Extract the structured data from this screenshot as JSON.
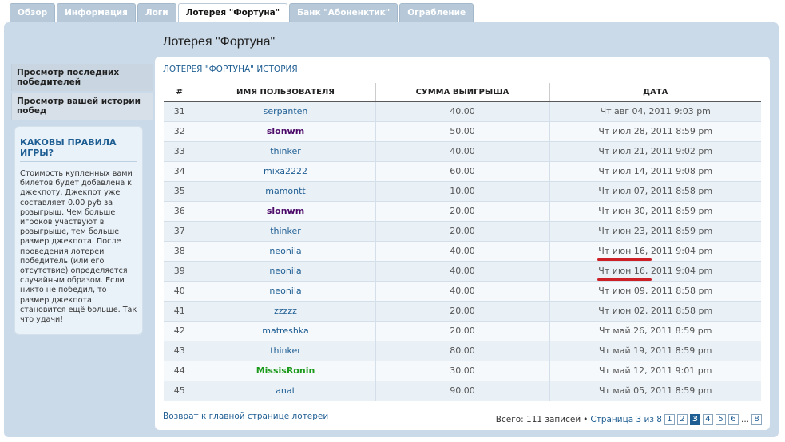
{
  "tabs": [
    {
      "label": "Обзор",
      "active": false
    },
    {
      "label": "Информация",
      "active": false
    },
    {
      "label": "Логи",
      "active": false
    },
    {
      "label": "Лотерея \"Фортуна\"",
      "active": true
    },
    {
      "label": "Банк \"Абоненктик\"",
      "active": false
    },
    {
      "label": "Ограбление",
      "active": false
    }
  ],
  "page_title": "Лотерея \"Фортуна\"",
  "sidebar": {
    "links": [
      {
        "label": "Просмотр последних победителей"
      },
      {
        "label": "Просмотр вашей истории побед"
      }
    ],
    "rules": {
      "title": "КАКОВЫ ПРАВИЛА ИГРЫ?",
      "text": "Стоимость купленных вами билетов будет добавлена к джекпоту. Джекпот уже составляет 0.00 руб за розыгрыш. Чем больше игроков участвуют в розыгрыше, тем больше размер джекпота. После проведения лотереи победитель (или его отсутствие) определяется случайным образом. Если никто не победил, то размер джекпота становится ещё больше. Так что удачи!"
    }
  },
  "history": {
    "title": "ЛОТЕРЕЯ \"ФОРТУНА\" ИСТОРИЯ",
    "columns": [
      "#",
      "ИМЯ ПОЛЬЗОВАТЕЛЯ",
      "СУММА ВЫИГРЫША",
      "ДАТА"
    ],
    "rows": [
      {
        "num": "31",
        "user": "serpanten",
        "style": "normal",
        "amount": "40.00",
        "date": "Чт авг 04, 2011 9:03 pm"
      },
      {
        "num": "32",
        "user": "slonwm",
        "style": "bold-purple",
        "amount": "50.00",
        "date": "Чт июл 28, 2011 8:59 pm"
      },
      {
        "num": "33",
        "user": "thinker",
        "style": "normal",
        "amount": "40.00",
        "date": "Чт июл 21, 2011 9:02 pm"
      },
      {
        "num": "34",
        "user": "mixa2222",
        "style": "normal",
        "amount": "60.00",
        "date": "Чт июл 14, 2011 9:08 pm"
      },
      {
        "num": "35",
        "user": "mamontt",
        "style": "normal",
        "amount": "10.00",
        "date": "Чт июл 07, 2011 8:58 pm"
      },
      {
        "num": "36",
        "user": "slonwm",
        "style": "bold-purple",
        "amount": "20.00",
        "date": "Чт июн 30, 2011 8:59 pm"
      },
      {
        "num": "37",
        "user": "thinker",
        "style": "normal",
        "amount": "20.00",
        "date": "Чт июн 23, 2011 8:59 pm"
      },
      {
        "num": "38",
        "user": "neonila",
        "style": "normal",
        "amount": "40.00",
        "date": "Чт июн 16, 2011 9:04 pm",
        "marked": true
      },
      {
        "num": "39",
        "user": "neonila",
        "style": "normal",
        "amount": "40.00",
        "date": "Чт июн 16, 2011 9:04 pm",
        "marked": true
      },
      {
        "num": "40",
        "user": "neonila",
        "style": "normal",
        "amount": "40.00",
        "date": "Чт июн 09, 2011 8:58 pm"
      },
      {
        "num": "41",
        "user": "zzzzz",
        "style": "normal",
        "amount": "20.00",
        "date": "Чт июн 02, 2011 8:58 pm"
      },
      {
        "num": "42",
        "user": "matreshka",
        "style": "normal",
        "amount": "20.00",
        "date": "Чт май 26, 2011 8:59 pm"
      },
      {
        "num": "43",
        "user": "thinker",
        "style": "normal",
        "amount": "80.00",
        "date": "Чт май 19, 2011 8:59 pm"
      },
      {
        "num": "44",
        "user": "MissisRonin",
        "style": "bold-green",
        "amount": "30.00",
        "date": "Чт май 12, 2011 9:01 pm"
      },
      {
        "num": "45",
        "user": "anat",
        "style": "normal",
        "amount": "90.00",
        "date": "Чт май 05, 2011 8:59 pm"
      }
    ]
  },
  "footer": {
    "back_link": "Возврат к главной странице лотереи",
    "total": "Всего: 111 записей",
    "bullet": "•",
    "page_info": "Страница 3 из 8",
    "pages": [
      "1",
      "2",
      "3",
      "4",
      "5",
      "6"
    ],
    "current_page": "3",
    "ellipsis": "...",
    "last_page": "8"
  },
  "colors": {
    "accent": "#1f5e93",
    "panel": "#cbdae8",
    "highlight_mark": "#cc1f26"
  }
}
